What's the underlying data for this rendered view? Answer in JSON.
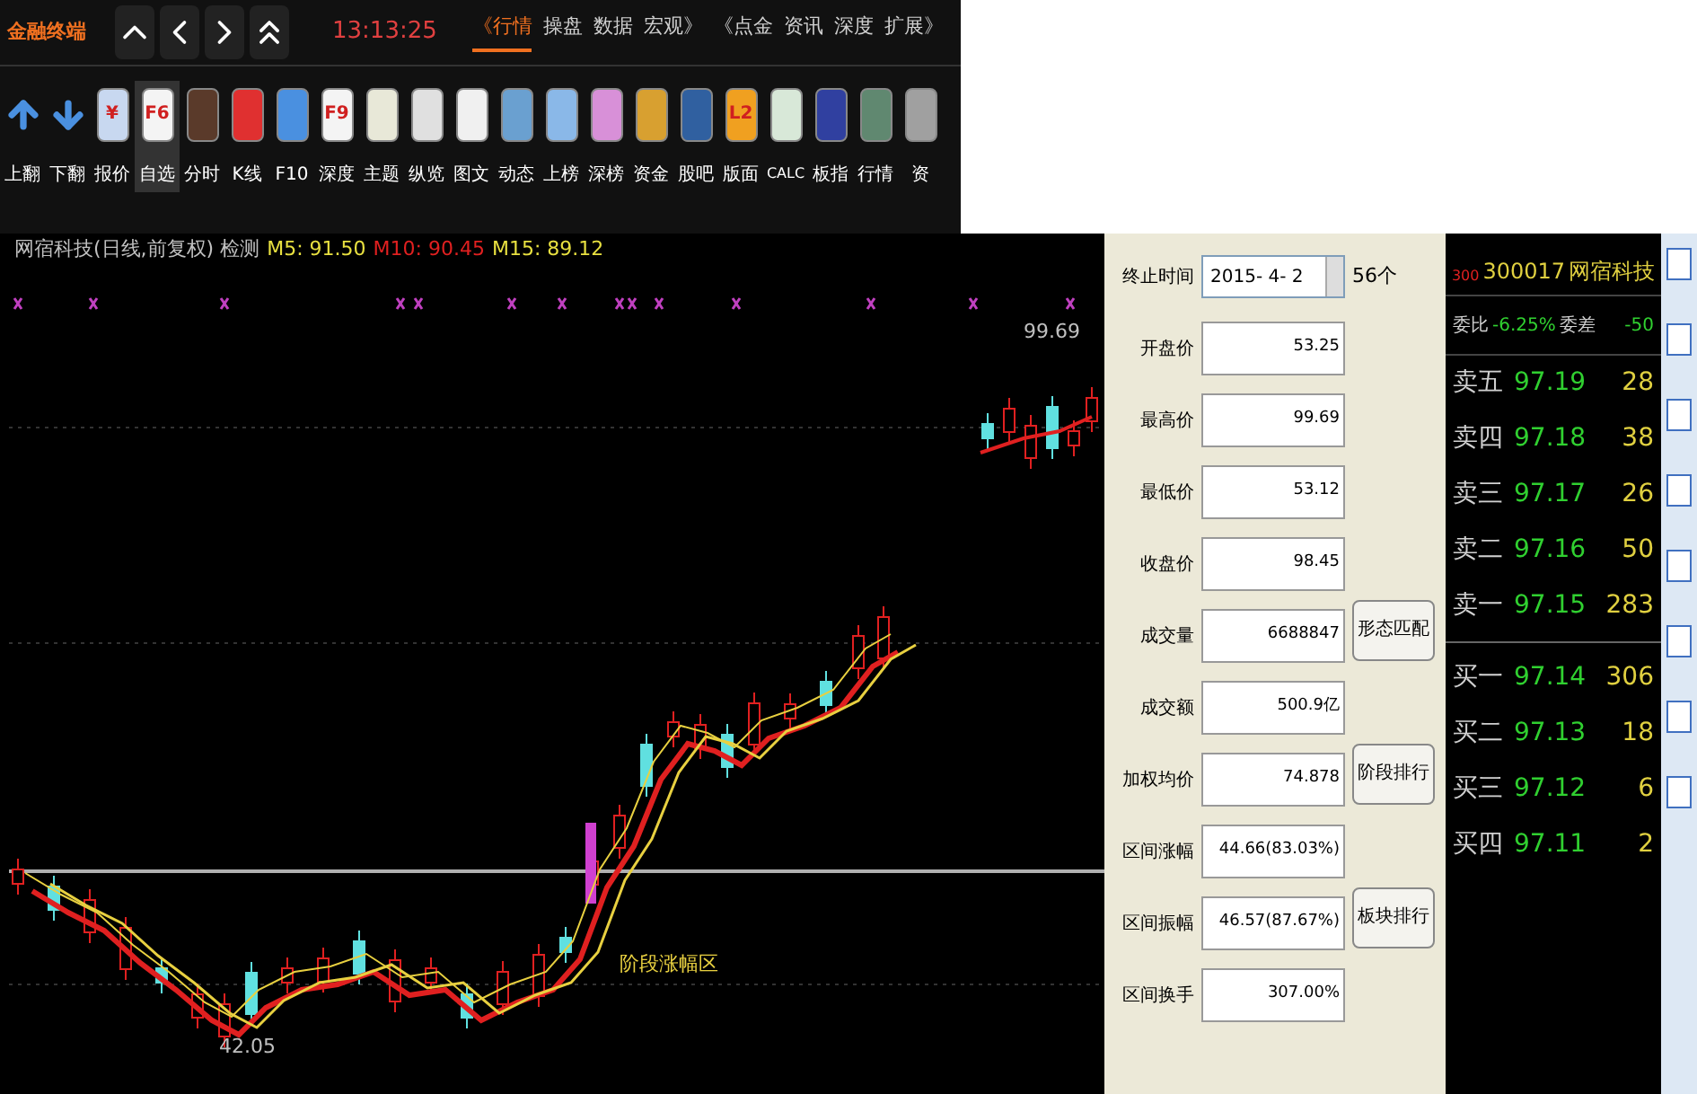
{
  "toolbar": {
    "logo": "金融终端",
    "time": "13:13:25",
    "tabs": [
      {
        "label": "《行情",
        "selected": true
      },
      {
        "label": "操盘",
        "selected": false
      },
      {
        "label": "数据",
        "selected": false
      },
      {
        "label": "宏观》",
        "selected": false
      },
      {
        "label": "《点金",
        "selected": false
      },
      {
        "label": "资讯",
        "selected": false
      },
      {
        "label": "深度",
        "selected": false
      },
      {
        "label": "扩展》",
        "selected": false
      }
    ],
    "buttons": [
      {
        "label": "上翻",
        "kind": "up",
        "selected": false
      },
      {
        "label": "下翻",
        "kind": "down",
        "selected": false
      },
      {
        "label": "报价",
        "kind": "tile",
        "color": "#c8d8f0",
        "badge": "¥",
        "selected": false
      },
      {
        "label": "自选",
        "kind": "tile",
        "color": "#f4f4f4",
        "badge": "F6",
        "selected": true
      },
      {
        "label": "分时",
        "kind": "tile",
        "color": "#5a3a2a",
        "selected": false
      },
      {
        "label": "K线",
        "kind": "tile",
        "color": "#e03030",
        "selected": false
      },
      {
        "label": "F10",
        "kind": "tile",
        "color": "#4a90e0",
        "selected": false
      },
      {
        "label": "深度",
        "kind": "tile",
        "color": "#f4f4f4",
        "badge": "F9",
        "selected": false
      },
      {
        "label": "主题",
        "kind": "tile",
        "color": "#e8e8d8",
        "selected": false
      },
      {
        "label": "纵览",
        "kind": "tile",
        "color": "#e0e0e0",
        "selected": false
      },
      {
        "label": "图文",
        "kind": "tile",
        "color": "#f0f0f0",
        "selected": false
      },
      {
        "label": "动态",
        "kind": "tile",
        "color": "#6aa0d0",
        "selected": false
      },
      {
        "label": "上榜",
        "kind": "tile",
        "color": "#8ab8e8",
        "selected": false
      },
      {
        "label": "深榜",
        "kind": "tile",
        "color": "#d890d8",
        "selected": false
      },
      {
        "label": "资金",
        "kind": "tile",
        "color": "#d8a030",
        "selected": false
      },
      {
        "label": "股吧",
        "kind": "tile",
        "color": "#3060a0",
        "selected": false
      },
      {
        "label": "版面",
        "kind": "tile",
        "color": "#f0a020",
        "badge": "L2",
        "selected": false
      },
      {
        "label": "CALC",
        "kind": "tile",
        "color": "#d8e8d8",
        "selected": false
      },
      {
        "label": "板指",
        "kind": "tile",
        "color": "#3040a0",
        "selected": false
      },
      {
        "label": "行情",
        "kind": "tile",
        "color": "#608870",
        "selected": false
      },
      {
        "label": "资",
        "kind": "tile",
        "color": "#a0a0a0",
        "selected": false
      }
    ]
  },
  "chart": {
    "title": "网宿科技(日线,前复权) 检测",
    "ma": [
      {
        "label": "M5: 91.50",
        "color": "#e8e040"
      },
      {
        "label": "M10: 90.45",
        "color": "#e02020"
      },
      {
        "label": "M15: 89.12",
        "color": "#e8e040"
      }
    ],
    "high_label": "99.69",
    "low_label": "42.05",
    "zone_label": "阶段涨幅区"
  },
  "dialog": {
    "end_time_label": "终止时间",
    "end_time": "2015- 4- 2",
    "count": "56个",
    "fields": [
      {
        "label": "开盘价",
        "value": "53.25"
      },
      {
        "label": "最高价",
        "value": "99.69"
      },
      {
        "label": "最低价",
        "value": "53.12"
      },
      {
        "label": "收盘价",
        "value": "98.45"
      },
      {
        "label": "成交量",
        "value": "6688847"
      },
      {
        "label": "成交额",
        "value": "500.9亿"
      },
      {
        "label": "加权均价",
        "value": "74.878"
      },
      {
        "label": "区间涨幅",
        "value": "44.66(83.03%)"
      },
      {
        "label": "区间振幅",
        "value": "46.57(87.67%)"
      },
      {
        "label": "区间换手",
        "value": "307.00%"
      }
    ],
    "buttons": [
      "形态匹配",
      "阶段排行",
      "板块排行"
    ]
  },
  "quote": {
    "prefix": "300",
    "code": "300017",
    "name": "网宿科技",
    "ratio_label": "委比",
    "ratio": "-6.25%",
    "diff_label": "委差",
    "diff": "-50",
    "asks": [
      {
        "label": "卖五",
        "price": "97.19",
        "volume": "28"
      },
      {
        "label": "卖四",
        "price": "97.18",
        "volume": "38"
      },
      {
        "label": "卖三",
        "price": "97.17",
        "volume": "26"
      },
      {
        "label": "卖二",
        "price": "97.16",
        "volume": "50"
      },
      {
        "label": "卖一",
        "price": "97.15",
        "volume": "283"
      }
    ],
    "bids": [
      {
        "label": "买一",
        "price": "97.14",
        "volume": "306"
      },
      {
        "label": "买二",
        "price": "97.13",
        "volume": "18"
      },
      {
        "label": "买三",
        "price": "97.12",
        "volume": "6"
      },
      {
        "label": "买四",
        "price": "97.11",
        "volume": "2"
      }
    ]
  }
}
